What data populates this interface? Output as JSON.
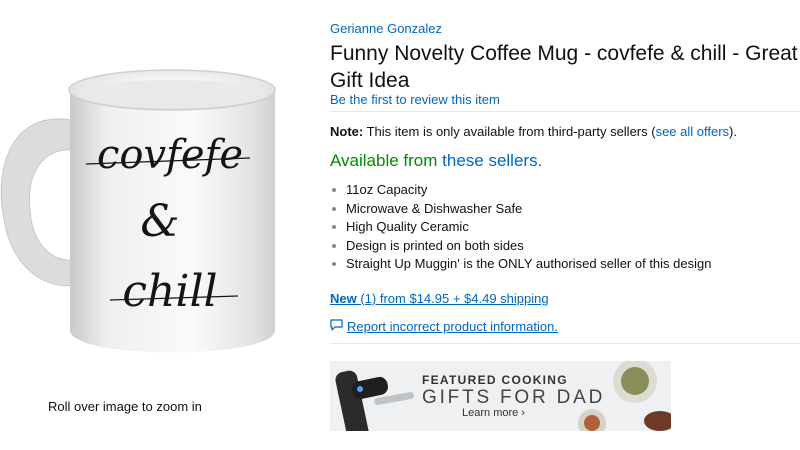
{
  "product_image": {
    "mug_text": [
      "covfefe",
      "&",
      "chill"
    ]
  },
  "zoom_hint": "Roll over image to zoom in",
  "brand": "Gerianne Gonzalez",
  "title": "Funny Novelty Coffee Mug - covfefe & chill - Great Gift Idea",
  "review_link": "Be the first to review this item",
  "note": {
    "label": "Note:",
    "text": " This item is only available from third-party sellers (",
    "link": "see all offers",
    "suffix": ")."
  },
  "availability": {
    "prefix": "Available from ",
    "link": "these sellers."
  },
  "bullets": [
    "11oz Capacity",
    "Microwave & Dishwasher Safe",
    "High Quality Ceramic",
    "Design is printed on both sides",
    "Straight Up Muggin' is the ONLY authorised seller of this design"
  ],
  "offer": {
    "condition": "New",
    "rest": " (1) from $14.95 + $4.49 shipping"
  },
  "report_link": "Report incorrect product information.",
  "banner": {
    "line1": "FEATURED COOKING",
    "line2": "GIFTS FOR DAD",
    "cta": "Learn more ›"
  },
  "colors": {
    "link": "#0066c0",
    "available": "#008a00",
    "text": "#111111"
  },
  "icons": [
    "speech-bubble-icon"
  ]
}
